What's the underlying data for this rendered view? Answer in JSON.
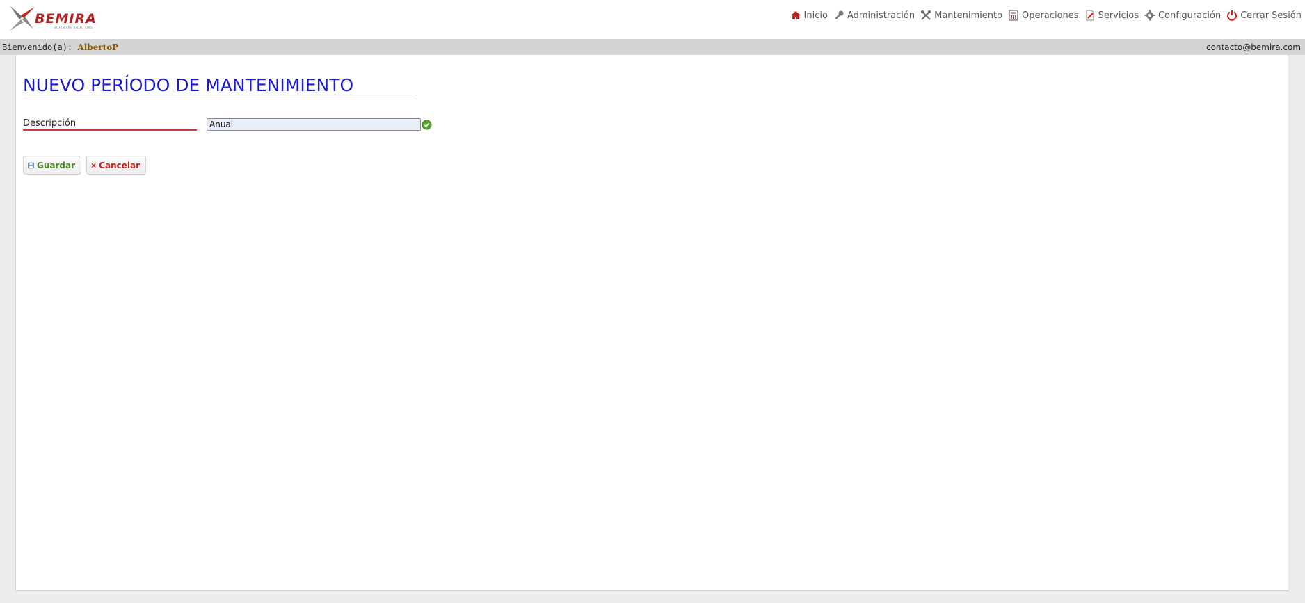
{
  "header": {
    "logo_text": "BEMIRA",
    "logo_subtitle": "SOFTWARE SOLUTIONS",
    "nav": [
      {
        "label": "Inicio",
        "icon": "home-icon"
      },
      {
        "label": "Administración",
        "icon": "key-icon"
      },
      {
        "label": "Mantenimiento",
        "icon": "tools-icon"
      },
      {
        "label": "Operaciones",
        "icon": "calculator-icon"
      },
      {
        "label": "Servicios",
        "icon": "document-edit-icon"
      },
      {
        "label": "Configuración",
        "icon": "gear-icon"
      },
      {
        "label": "Cerrar Sesión",
        "icon": "power-icon"
      }
    ]
  },
  "userbar": {
    "welcome_label": "Bienvenido(a):",
    "username": "AlbertoP",
    "email": "contacto@bemira.com"
  },
  "form": {
    "title": "NUEVO PERÍODO DE MANTENIMIENTO",
    "description_label": "Descripción",
    "description_value": "Anual",
    "save_label": "Guardar",
    "cancel_label": "Cancelar"
  },
  "colors": {
    "title": "#1a1acc",
    "username": "#8b5a00",
    "save": "#4a8a22",
    "cancel": "#c0221a",
    "label_underline": "#c83a3a",
    "input_bg": "#e8effb"
  }
}
